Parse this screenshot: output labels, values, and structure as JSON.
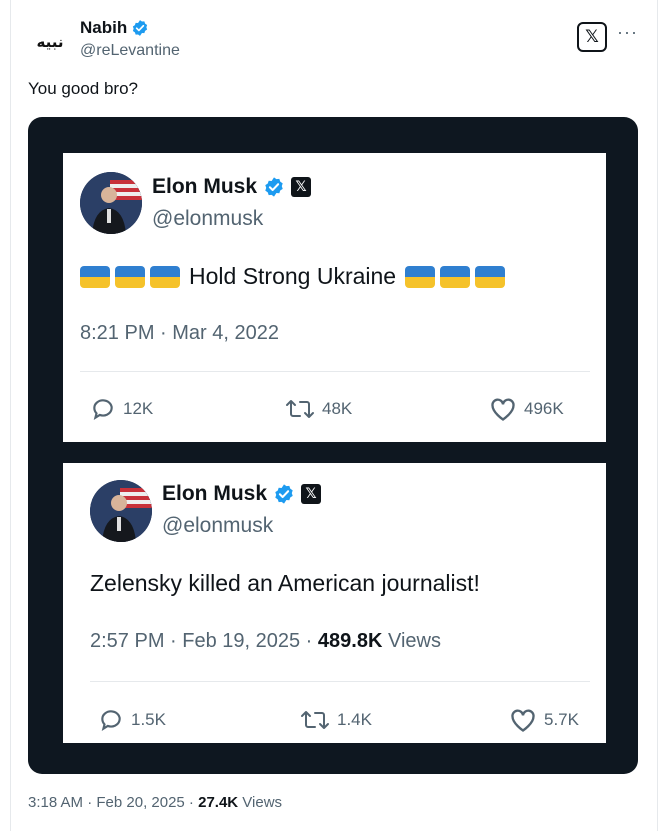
{
  "author": {
    "name": "Nabih",
    "handle": "@reLevantine",
    "logo_text": "نبيه"
  },
  "tweet_text": "You good bro?",
  "embeds": [
    {
      "name": "Elon Musk",
      "handle": "@elonmusk",
      "body": "Hold Strong Ukraine",
      "time": "8:21 PM · Mar 4, 2022",
      "replies": "12K",
      "reposts": "48K",
      "likes": "496K"
    },
    {
      "name": "Elon Musk",
      "handle": "@elonmusk",
      "body": "Zelensky killed an American journalist!",
      "time": "2:57 PM · Feb 19, 2025 · ",
      "views_count": "489.8K",
      "views_label": " Views",
      "replies": "1.5K",
      "reposts": "1.4K",
      "likes": "5.7K"
    }
  ],
  "footer": {
    "time": "3:18 AM · Feb 20, 2025 · ",
    "views_count": "27.4K",
    "views_label": " Views"
  },
  "icons": {
    "verified_color": "#1d9bf0",
    "flag_colors": [
      "#2f7fd0",
      "#f5c22a"
    ]
  }
}
